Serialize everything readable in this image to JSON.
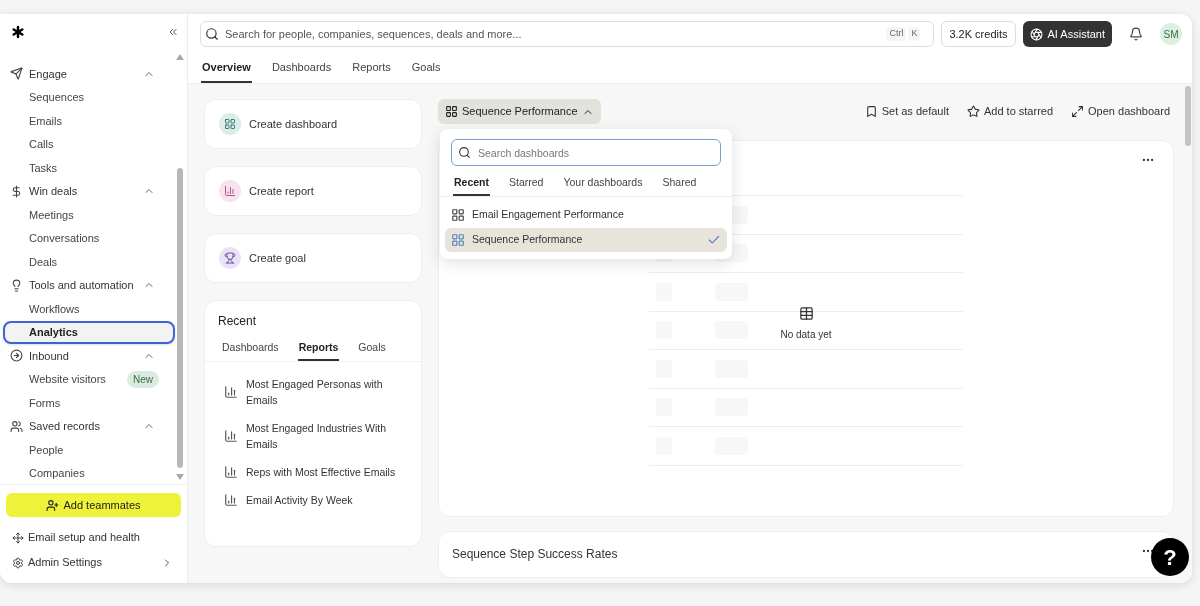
{
  "sidebar": {
    "groups": [
      {
        "label": "Engage",
        "expanded": true,
        "items": [
          {
            "label": "Sequences",
            "selected": false
          },
          {
            "label": "Emails",
            "selected": false
          },
          {
            "label": "Calls",
            "selected": false
          },
          {
            "label": "Tasks",
            "selected": false
          }
        ]
      },
      {
        "label": "Win deals",
        "expanded": true,
        "items": [
          {
            "label": "Meetings",
            "selected": false
          },
          {
            "label": "Conversations",
            "selected": false
          },
          {
            "label": "Deals",
            "selected": false
          }
        ]
      },
      {
        "label": "Tools and automation",
        "expanded": true,
        "items": [
          {
            "label": "Workflows",
            "selected": false
          },
          {
            "label": "Analytics",
            "selected": true
          }
        ]
      },
      {
        "label": "Inbound",
        "expanded": true,
        "items": [
          {
            "label": "Website visitors",
            "selected": false,
            "badge": "New"
          },
          {
            "label": "Forms",
            "selected": false
          }
        ]
      },
      {
        "label": "Saved records",
        "expanded": true,
        "items": [
          {
            "label": "People",
            "selected": false
          },
          {
            "label": "Companies",
            "selected": false
          }
        ]
      }
    ],
    "add_button": "Add teammates",
    "footer_links": [
      {
        "label": "Email setup and health",
        "arrow": false
      },
      {
        "label": "Admin Settings",
        "arrow": true
      }
    ]
  },
  "search": {
    "placeholder": "Search for people, companies, sequences, deals and more...",
    "keys": [
      "Ctrl",
      "K"
    ]
  },
  "credits": "3.2K credits",
  "assistant": "AI Assistant",
  "avatar": "SM",
  "tabs": [
    {
      "label": "Overview",
      "selected": true
    },
    {
      "label": "Dashboards",
      "selected": false
    },
    {
      "label": "Reports",
      "selected": false
    },
    {
      "label": "Goals",
      "selected": false
    }
  ],
  "quick_actions": [
    {
      "kind": "dashboard",
      "label": "Create dashboard"
    },
    {
      "kind": "report",
      "label": "Create report"
    },
    {
      "kind": "goal",
      "label": "Create goal"
    }
  ],
  "recent": {
    "title": "Recent",
    "tabs": [
      {
        "label": "Dashboards",
        "selected": false
      },
      {
        "label": "Reports",
        "selected": true
      },
      {
        "label": "Goals",
        "selected": false
      }
    ],
    "items": [
      "Most Engaged Personas with Emails",
      "Most Engaged Industries With Emails",
      "Reps with Most Effective Emails",
      "Email Activity By Week"
    ]
  },
  "dashboard_picker": {
    "label": "Sequence Performance",
    "expanded": true,
    "search_placeholder": "Search dashboards",
    "tabs": [
      {
        "label": "Recent",
        "selected": true
      },
      {
        "label": "Starred",
        "selected": false
      },
      {
        "label": "Your dashboards",
        "selected": false
      },
      {
        "label": "Shared",
        "selected": false
      }
    ],
    "items": [
      {
        "label": "Email Engagement Performance",
        "selected": false
      },
      {
        "label": "Sequence Performance",
        "selected": true
      }
    ]
  },
  "actions": [
    {
      "kind": "default",
      "label": "Set as default"
    },
    {
      "kind": "star",
      "label": "Add to starred"
    },
    {
      "kind": "open",
      "label": "Open dashboard"
    }
  ],
  "cards": [
    {
      "empty_text": "No data yet"
    },
    {
      "title": "Sequence Step Success Rates"
    }
  ],
  "help": "?"
}
